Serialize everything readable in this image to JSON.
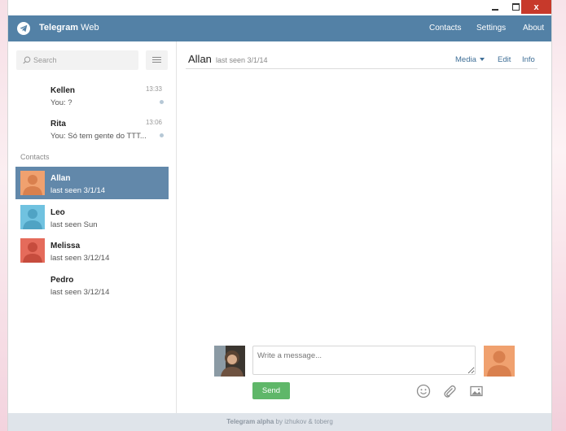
{
  "header": {
    "app_title_bold": "Telegram",
    "app_title_rest": " Web",
    "nav": [
      "Contacts",
      "Settings",
      "About"
    ]
  },
  "window_controls": {
    "minimize": "minimize-icon",
    "maximize": "maximize-icon",
    "close": "x"
  },
  "search": {
    "placeholder": "Search"
  },
  "dialogs": [
    {
      "name": "Kellen",
      "message": "You: ?",
      "time": "13:33"
    },
    {
      "name": "Rita",
      "message": "You: Só tem gente do TTT...",
      "time": "13:06"
    }
  ],
  "contacts_label": "Contacts",
  "contacts": [
    {
      "name": "Allan",
      "status": "last seen 3/1/14",
      "avatar_color": "#f0a16f"
    },
    {
      "name": "Leo",
      "status": "last seen Sun",
      "avatar_color": "#70c2e0"
    },
    {
      "name": "Melissa",
      "status": "last seen 3/12/14",
      "avatar_color": "#e56b5b"
    },
    {
      "name": "Pedro",
      "status": "last seen 3/12/14",
      "avatar_color": ""
    }
  ],
  "peer": {
    "name": "Allan",
    "status": "last seen 3/1/14",
    "actions": {
      "media": "Media",
      "edit": "Edit",
      "info": "Info"
    }
  },
  "composer": {
    "placeholder": "Write a message...",
    "send_label": "Send",
    "tools": [
      "emoji-icon",
      "attach-icon",
      "photo-icon"
    ]
  },
  "footer": {
    "bold": "Telegram alpha",
    "rest": " by izhukov & toberg"
  },
  "colors": {
    "header": "#5381a6",
    "active_item": "#6288aa",
    "send_button": "#5fb769",
    "close_button": "#c7392b",
    "link": "#3f6f97"
  }
}
